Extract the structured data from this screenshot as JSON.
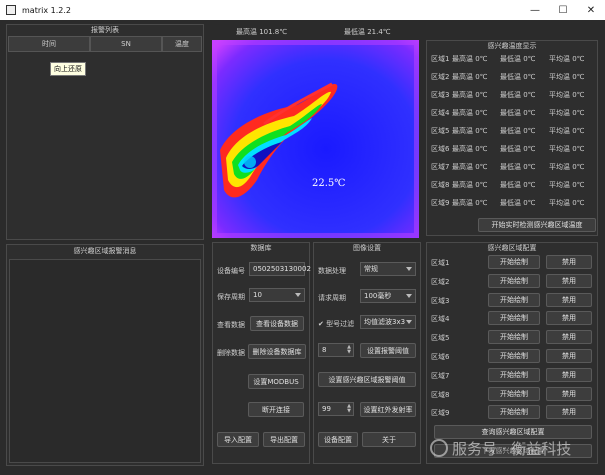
{
  "window": {
    "title": "matrix 1.2.2"
  },
  "alarm_list": {
    "title": "报警列表",
    "columns": [
      "时间",
      "SN",
      "温度"
    ],
    "tooltip": "向上还原"
  },
  "roi_messages": {
    "title": "感兴趣区域报警消息"
  },
  "image": {
    "max_temp": "最高温 101.8℃",
    "min_temp": "最低温 21.4℃",
    "cursor_temp": "22.5℃"
  },
  "roi_temps": {
    "title": "感兴趣温度显示",
    "rows": [
      {
        "zone": "区域1",
        "max": "最高温 0℃",
        "min": "最低温 0℃",
        "avg": "平均温 0℃"
      },
      {
        "zone": "区域2",
        "max": "最高温 0℃",
        "min": "最低温 0℃",
        "avg": "平均温 0℃"
      },
      {
        "zone": "区域3",
        "max": "最高温 0℃",
        "min": "最低温 0℃",
        "avg": "平均温 0℃"
      },
      {
        "zone": "区域4",
        "max": "最高温 0℃",
        "min": "最低温 0℃",
        "avg": "平均温 0℃"
      },
      {
        "zone": "区域5",
        "max": "最高温 0℃",
        "min": "最低温 0℃",
        "avg": "平均温 0℃"
      },
      {
        "zone": "区域6",
        "max": "最高温 0℃",
        "min": "最低温 0℃",
        "avg": "平均温 0℃"
      },
      {
        "zone": "区域7",
        "max": "最高温 0℃",
        "min": "最低温 0℃",
        "avg": "平均温 0℃"
      },
      {
        "zone": "区域8",
        "max": "最高温 0℃",
        "min": "最低温 0℃",
        "avg": "平均温 0℃"
      },
      {
        "zone": "区域9",
        "max": "最高温 0℃",
        "min": "最低温 0℃",
        "avg": "平均温 0℃"
      }
    ],
    "start_button": "开始实时检测感兴趣区域温度"
  },
  "database": {
    "title": "数据库",
    "device_id_label": "设备编号",
    "device_id_value": "0502503130002",
    "retention_label": "保存周期",
    "retention_value": "10",
    "query_label": "查看数据",
    "query_button": "查看设备数据",
    "delete_label": "删除数据",
    "delete_button": "删除设备数据库",
    "modbus_button": "设置MODBUS",
    "disconnect_button": "断开连接",
    "import_button": "导入配置",
    "export_button": "导出配置"
  },
  "image_settings": {
    "title": "图像设置",
    "processing_label": "数据处理",
    "processing_value": "常规",
    "request_label": "请求周期",
    "request_value": "100毫秒",
    "filter_label": "型号过滤",
    "filter_value": "均值滤波3x3",
    "threshold_value": "8",
    "threshold_button": "设置报警阈值",
    "roi_threshold_button": "设置感兴趣区域报警阈值",
    "emissivity_value": "99",
    "emissivity_button": "设置红外发射率",
    "device_config_button": "设备配置",
    "about_button": "关于"
  },
  "roi_config": {
    "title": "感兴趣区域配置",
    "zones": [
      "区域1",
      "区域2",
      "区域3",
      "区域4",
      "区域5",
      "区域6",
      "区域7",
      "区域8",
      "区域9"
    ],
    "draw_label": "开始绘制",
    "disable_label": "禁用",
    "query_button": "查询感兴趣区域配置",
    "send_button": "下发感兴趣区域配置"
  },
  "watermark": "服务号 · 衡益科技",
  "colors": {
    "background": "#2b2b2b",
    "panel": "#2e2e2e",
    "button": "#3d3d3d"
  }
}
